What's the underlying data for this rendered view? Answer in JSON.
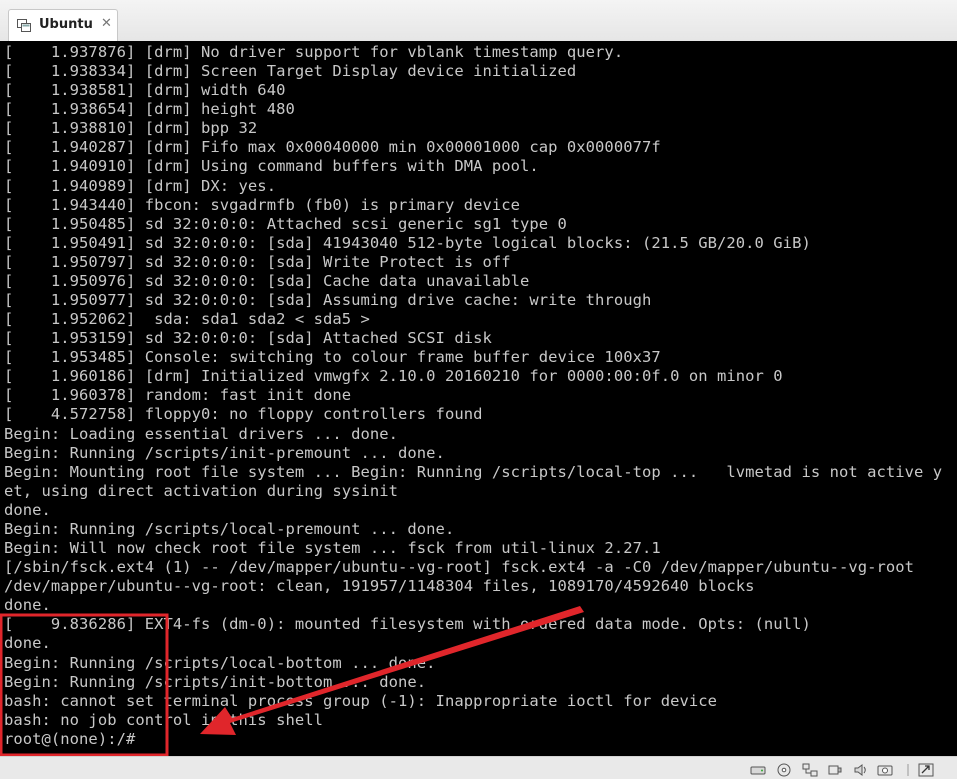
{
  "window": {
    "tab_title": "Ubuntu",
    "tab_icon": "vm-icon",
    "close_glyph": "✕"
  },
  "console": {
    "lines": [
      "[    1.937876] [drm] No driver support for vblank timestamp query.",
      "[    1.938334] [drm] Screen Target Display device initialized",
      "[    1.938581] [drm] width 640",
      "[    1.938654] [drm] height 480",
      "[    1.938810] [drm] bpp 32",
      "[    1.940287] [drm] Fifo max 0x00040000 min 0x00001000 cap 0x0000077f",
      "[    1.940910] [drm] Using command buffers with DMA pool.",
      "[    1.940989] [drm] DX: yes.",
      "[    1.943440] fbcon: svgadrmfb (fb0) is primary device",
      "[    1.950485] sd 32:0:0:0: Attached scsi generic sg1 type 0",
      "[    1.950491] sd 32:0:0:0: [sda] 41943040 512-byte logical blocks: (21.5 GB/20.0 GiB)",
      "[    1.950797] sd 32:0:0:0: [sda] Write Protect is off",
      "[    1.950976] sd 32:0:0:0: [sda] Cache data unavailable",
      "[    1.950977] sd 32:0:0:0: [sda] Assuming drive cache: write through",
      "[    1.952062]  sda: sda1 sda2 < sda5 >",
      "[    1.953159] sd 32:0:0:0: [sda] Attached SCSI disk",
      "[    1.953485] Console: switching to colour frame buffer device 100x37",
      "[    1.960186] [drm] Initialized vmwgfx 2.10.0 20160210 for 0000:00:0f.0 on minor 0",
      "[    1.960378] random: fast init done",
      "[    4.572758] floppy0: no floppy controllers found",
      "Begin: Loading essential drivers ... done.",
      "Begin: Running /scripts/init-premount ... done.",
      "Begin: Mounting root file system ... Begin: Running /scripts/local-top ...   lvmetad is not active y",
      "et, using direct activation during sysinit",
      "done.",
      "Begin: Running /scripts/local-premount ... done.",
      "Begin: Will now check root file system ... fsck from util-linux 2.27.1",
      "[/sbin/fsck.ext4 (1) -- /dev/mapper/ubuntu--vg-root] fsck.ext4 -a -C0 /dev/mapper/ubuntu--vg-root",
      "/dev/mapper/ubuntu--vg-root: clean, 191957/1148304 files, 1089170/4592640 blocks",
      "done.",
      "[    9.836286] EXT4-fs (dm-0): mounted filesystem with ordered data mode. Opts: (null)",
      "done.",
      "Begin: Running /scripts/local-bottom ... done.",
      "Begin: Running /scripts/init-bottom ... done.",
      "bash: cannot set terminal process group (-1): Inappropriate ioctl for device",
      "bash: no job control in this shell",
      "root@(none):/#"
    ]
  },
  "annotation": {
    "highlight_color": "#e0262b",
    "shape": "rectangle-with-arrow"
  },
  "statusbar": {
    "icons": [
      "hard-disk-icon",
      "cd-rom-icon",
      "network-icon",
      "usb-icon",
      "sound-icon",
      "camera-icon",
      "separator-icon",
      "keyboard-grab-icon"
    ]
  },
  "colors": {
    "console_bg": "#000000",
    "console_fg": "#c8c8c8"
  }
}
